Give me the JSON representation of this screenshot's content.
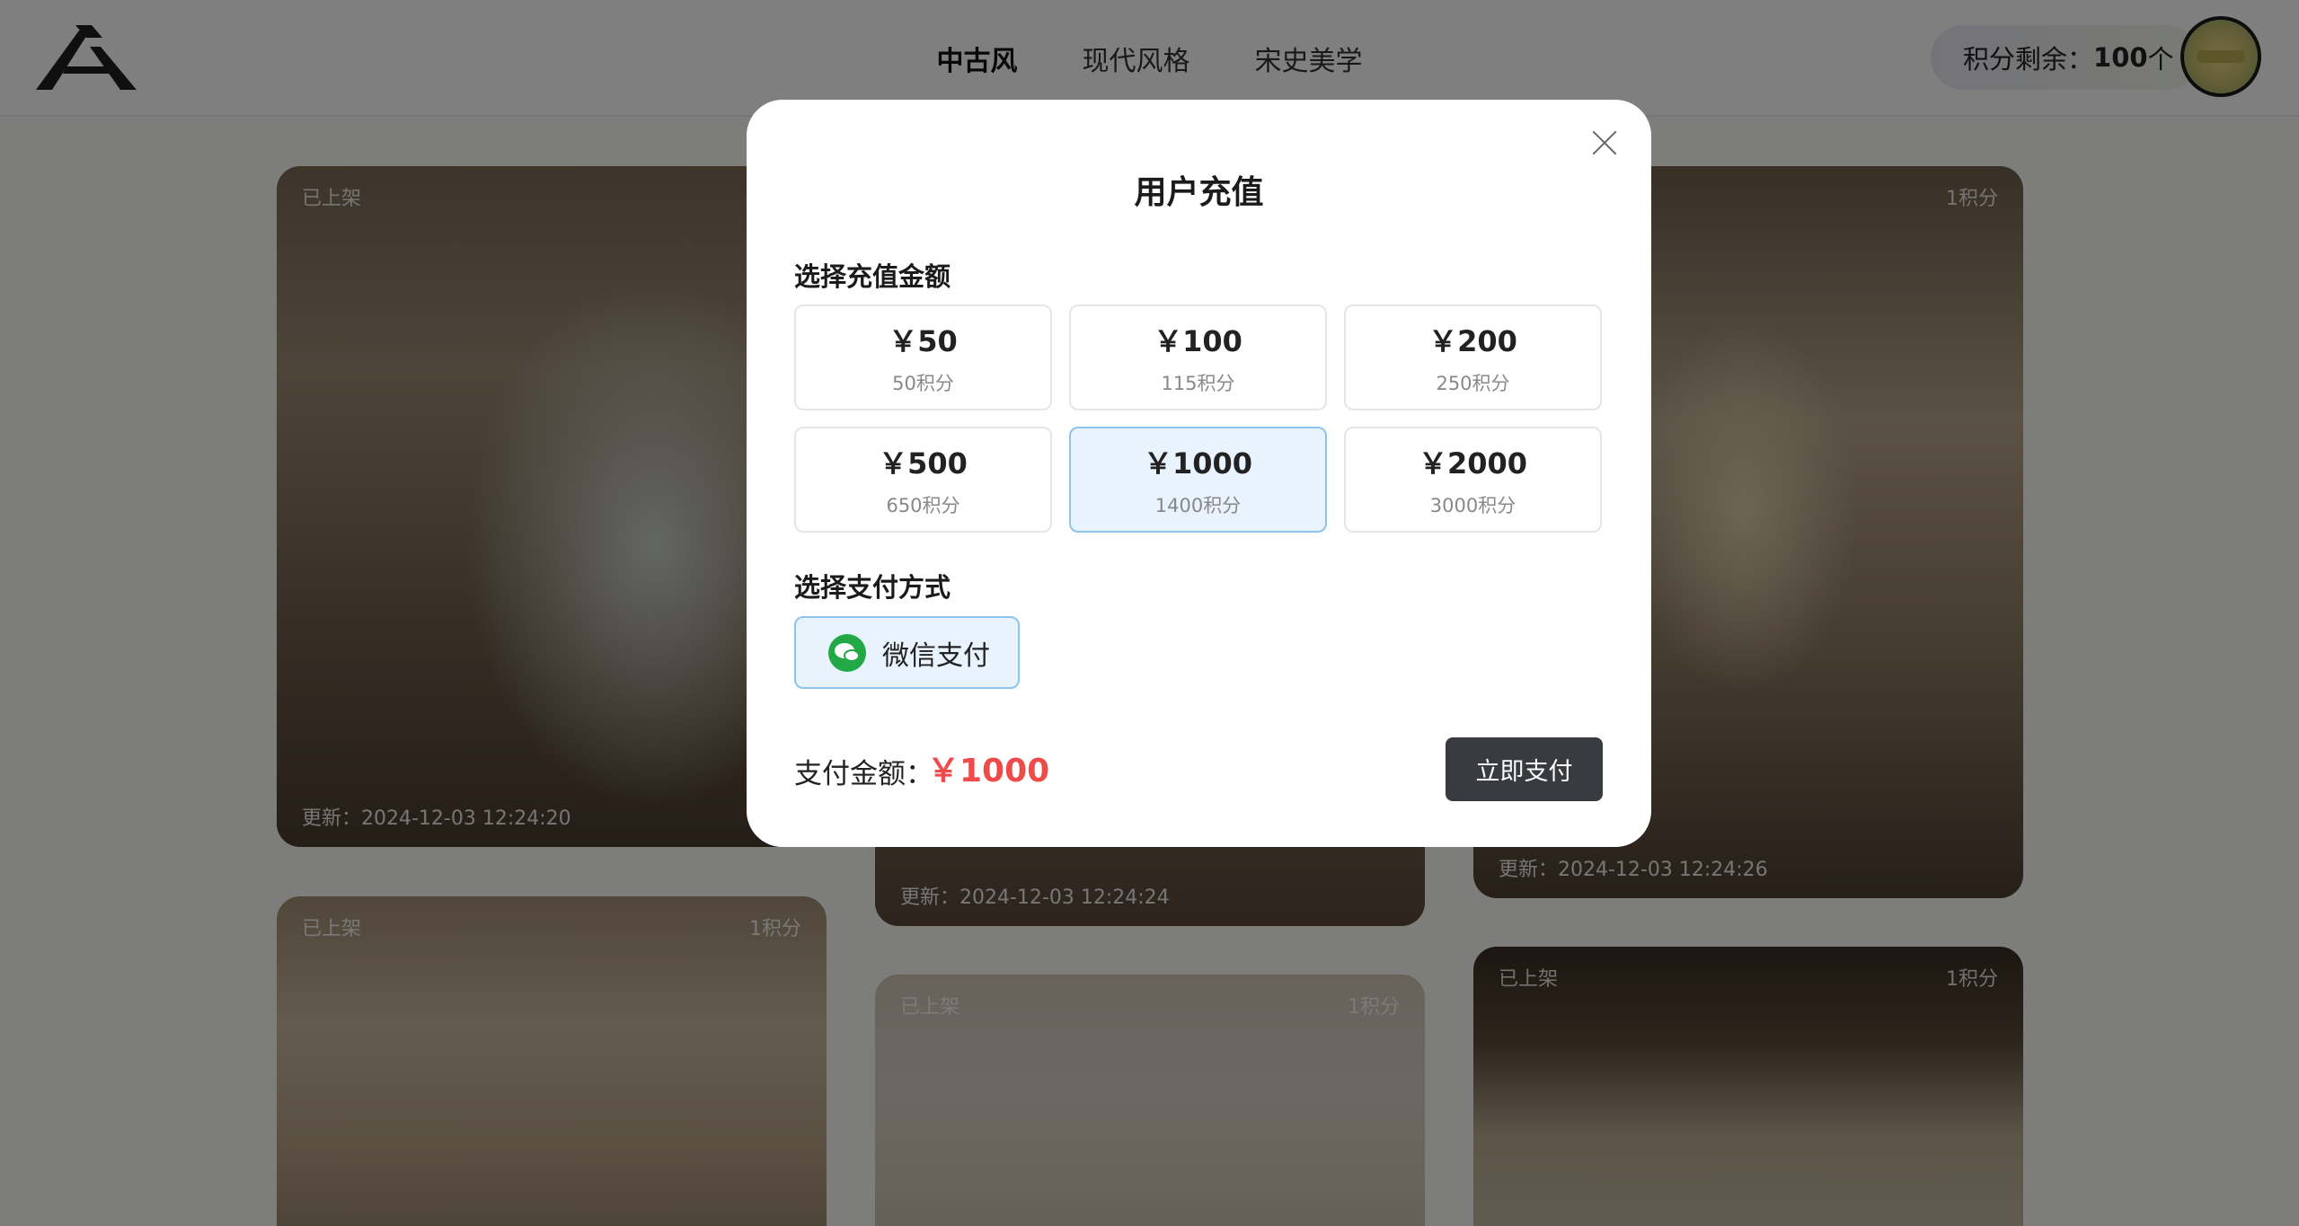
{
  "header": {
    "logo_icon": "brand-logo",
    "nav": [
      {
        "label": "中古风",
        "active": true
      },
      {
        "label": "现代风格",
        "active": false
      },
      {
        "label": "宋史美学",
        "active": false
      }
    ],
    "points_label": "积分剩余：",
    "points_value": "100",
    "points_unit": "个"
  },
  "cards": [
    {
      "status": "已上架",
      "points": "",
      "updated": "更新：2024-12-03 12:24:20"
    },
    {
      "status": "",
      "points": "",
      "updated": "更新：2024-12-03 12:24:24"
    },
    {
      "status": "",
      "points": "1积分",
      "updated": "更新：2024-12-03 12:24:26"
    },
    {
      "status": "已上架",
      "points": "1积分",
      "updated": ""
    },
    {
      "status": "已上架",
      "points": "1积分",
      "updated": ""
    },
    {
      "status": "已上架",
      "points": "1积分",
      "updated": ""
    }
  ],
  "modal": {
    "title": "用户充值",
    "amount_section_title": "选择充值金额",
    "options": [
      {
        "price": "￥50",
        "points": "50积分",
        "selected": false
      },
      {
        "price": "￥100",
        "points": "115积分",
        "selected": false
      },
      {
        "price": "￥200",
        "points": "250积分",
        "selected": false
      },
      {
        "price": "￥500",
        "points": "650积分",
        "selected": false
      },
      {
        "price": "￥1000",
        "points": "1400积分",
        "selected": true
      },
      {
        "price": "￥2000",
        "points": "3000积分",
        "selected": false
      }
    ],
    "payment_section_title": "选择支付方式",
    "payment_method": {
      "label": "微信支付",
      "icon": "wechat-pay-icon"
    },
    "amount_label": "支付金额：",
    "amount_value": "￥1000",
    "pay_button": "立即支付",
    "close_icon": "close-icon"
  },
  "colors": {
    "selected_bg": "#e8f3fd",
    "selected_border": "#8bc4ee",
    "amount": "#ef4b4b",
    "pay_button": "#383b40",
    "overlay": "rgba(0,0,0,0.5)"
  }
}
